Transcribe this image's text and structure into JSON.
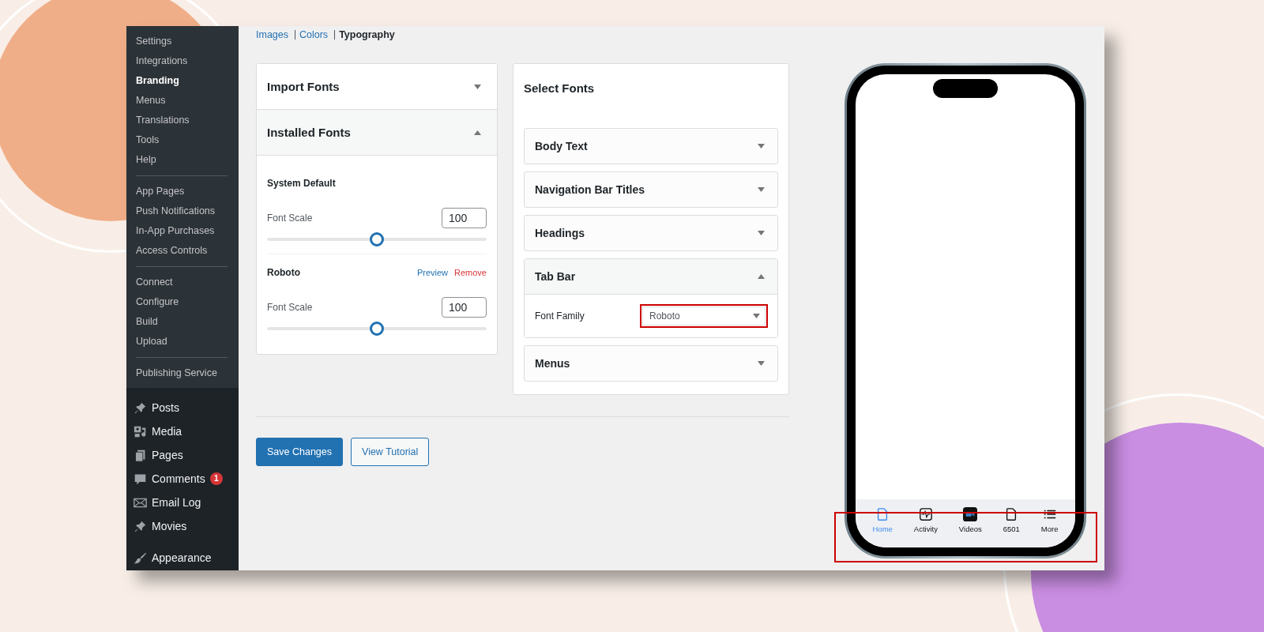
{
  "sidebar": {
    "groups": [
      [
        {
          "label": "Settings",
          "selected": false
        },
        {
          "label": "Integrations",
          "selected": false
        },
        {
          "label": "Branding",
          "selected": true
        },
        {
          "label": "Menus",
          "selected": false
        },
        {
          "label": "Translations",
          "selected": false
        },
        {
          "label": "Tools",
          "selected": false
        },
        {
          "label": "Help",
          "selected": false
        }
      ],
      [
        {
          "label": "App Pages",
          "selected": false
        },
        {
          "label": "Push Notifications",
          "selected": false
        },
        {
          "label": "In-App Purchases",
          "selected": false
        },
        {
          "label": "Access Controls",
          "selected": false
        }
      ],
      [
        {
          "label": "Connect",
          "selected": false
        },
        {
          "label": "Configure",
          "selected": false
        },
        {
          "label": "Build",
          "selected": false
        },
        {
          "label": "Upload",
          "selected": false
        }
      ],
      [
        {
          "label": "Publishing Service",
          "selected": false
        }
      ]
    ],
    "menu": [
      {
        "label": "Posts"
      },
      {
        "label": "Media"
      },
      {
        "label": "Pages"
      },
      {
        "label": "Comments",
        "badge": "1"
      },
      {
        "label": "Email Log"
      },
      {
        "label": "Movies"
      },
      {
        "label": "Appearance"
      }
    ]
  },
  "subnav": [
    {
      "label": "Images",
      "selected": false
    },
    {
      "label": "Colors",
      "selected": false
    },
    {
      "label": "Typography",
      "selected": true
    }
  ],
  "fonts_panel": {
    "sections": [
      {
        "title": "Import Fonts",
        "expanded": false
      },
      {
        "title": "Installed Fonts",
        "expanded": true
      }
    ],
    "installed": [
      {
        "name": "System Default",
        "scale_label": "Font Scale",
        "scale": "100",
        "level": 0.5
      },
      {
        "name": "Roboto",
        "preview": "Preview",
        "remove": "Remove",
        "scale_label": "Font Scale",
        "scale": "100",
        "level": 0.5
      }
    ]
  },
  "select_panel": {
    "title": "Select Fonts",
    "sections": [
      {
        "title": "Body Text",
        "expanded": false
      },
      {
        "title": "Navigation Bar Titles",
        "expanded": false
      },
      {
        "title": "Headings",
        "expanded": false
      },
      {
        "title": "Tab Bar",
        "expanded": true,
        "field_label": "Font Family",
        "value": "Roboto",
        "highlighted": true
      },
      {
        "title": "Menus",
        "expanded": false
      }
    ]
  },
  "buttons": {
    "save": "Save Changes",
    "tutorial": "View Tutorial"
  },
  "phone": {
    "tab_bar": {
      "highlighted": true,
      "items": [
        {
          "label": "Home",
          "selected": true
        },
        {
          "label": "Activity",
          "selected": false
        },
        {
          "label": "Videos",
          "selected": false
        },
        {
          "label": "6501",
          "selected": false
        },
        {
          "label": "More",
          "selected": false
        }
      ]
    }
  }
}
